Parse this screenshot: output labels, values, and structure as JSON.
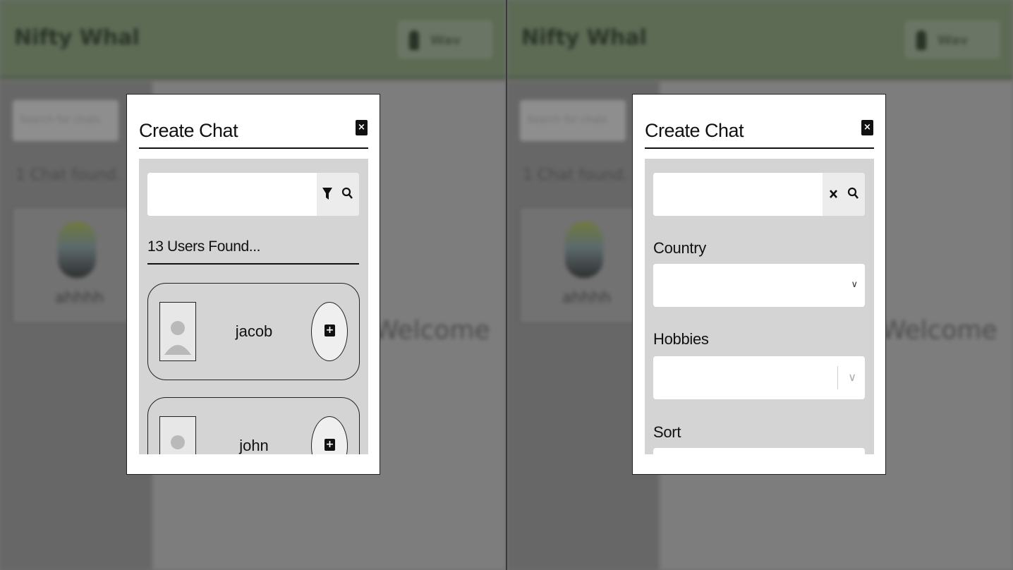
{
  "background": {
    "logo_text": "Nifty Whal",
    "user_badge_text": "Wav",
    "search_placeholder": "Search for chats",
    "chats_found": "1 Chat found.",
    "chat_card_name": "ahhhh",
    "welcome_text": "Welcome"
  },
  "left_modal": {
    "title": "Create Chat",
    "close_label": "×",
    "search": {
      "value": "",
      "placeholder": ""
    },
    "buttons": {
      "filter_icon": "filter-icon",
      "search_icon": "search-icon"
    },
    "found_text": "13 Users Found...",
    "users": [
      {
        "name": "jacob"
      },
      {
        "name": "john"
      }
    ]
  },
  "right_modal": {
    "title": "Create Chat",
    "close_label": "×",
    "search": {
      "value": "",
      "placeholder": ""
    },
    "buttons": {
      "clear_icon": "close-icon",
      "search_icon": "search-icon"
    },
    "filters": {
      "country_label": "Country",
      "country_value": "",
      "hobbies_label": "Hobbies",
      "hobbies_value": "",
      "sort_label": "Sort"
    }
  },
  "colors": {
    "header_bg": "#5d6b55",
    "panel_bg": "#d4d4d4",
    "modal_bg": "#ffffff"
  }
}
